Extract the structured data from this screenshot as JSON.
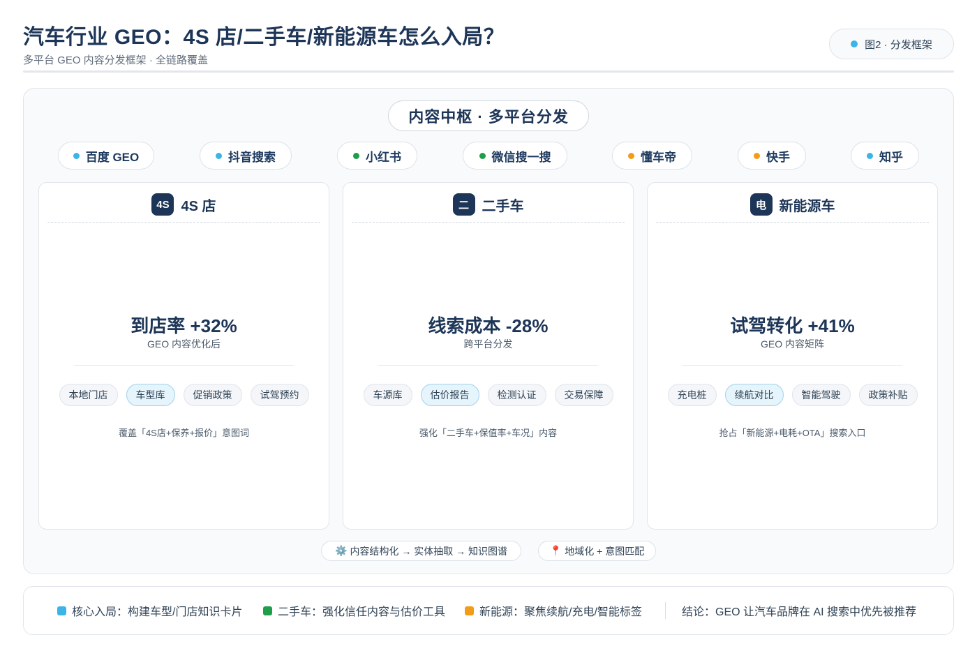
{
  "header": {
    "title": "汽车行业 GEO：4S 店/二手车/新能源车怎么入局？",
    "subtitle": "多平台 GEO 内容分发框架 · 全链路覆盖",
    "figure_badge": "图2 · 分发框架",
    "figure_badge_color": "#3cb4e6"
  },
  "hub": {
    "label": "内容中枢 · 多平台分发"
  },
  "platforms": [
    {
      "label": "百度 GEO",
      "color": "#3cb4e6"
    },
    {
      "label": "抖音搜索",
      "color": "#3cb4e6"
    },
    {
      "label": "小红书",
      "color": "#1e9e4a"
    },
    {
      "label": "微信搜一搜",
      "color": "#1e9e4a"
    },
    {
      "label": "懂车帝",
      "color": "#f39c1a"
    },
    {
      "label": "快手",
      "color": "#f39c1a"
    },
    {
      "label": "知乎",
      "color": "#3cb4e6"
    }
  ],
  "cards": [
    {
      "icon_text": "4S",
      "name": "4S 店",
      "metric": "到店率 +32%",
      "metric_sub": "GEO 内容优化后",
      "tags": [
        {
          "label": "本地门店",
          "highlight": false
        },
        {
          "label": "车型库",
          "highlight": true
        },
        {
          "label": "促销政策",
          "highlight": false
        },
        {
          "label": "试驾预约",
          "highlight": false
        }
      ],
      "note": "覆盖「4S店+保养+报价」意图词"
    },
    {
      "icon_text": "二",
      "name": "二手车",
      "metric": "线索成本 -28%",
      "metric_sub": "跨平台分发",
      "tags": [
        {
          "label": "车源库",
          "highlight": false
        },
        {
          "label": "估价报告",
          "highlight": true
        },
        {
          "label": "检测认证",
          "highlight": false
        },
        {
          "label": "交易保障",
          "highlight": false
        }
      ],
      "note": "强化「二手车+保值率+车况」内容"
    },
    {
      "icon_text": "电",
      "name": "新能源车",
      "metric": "试驾转化 +41%",
      "metric_sub": "GEO 内容矩阵",
      "tags": [
        {
          "label": "充电桩",
          "highlight": false
        },
        {
          "label": "续航对比",
          "highlight": true
        },
        {
          "label": "智能驾驶",
          "highlight": false
        },
        {
          "label": "政策补贴",
          "highlight": false
        }
      ],
      "note": "抢占「新能源+电耗+OTA」搜索入口"
    }
  ],
  "tech_pills": [
    {
      "icon": "⚙️",
      "icon_name": "gear-icon",
      "label": "内容结构化 → 实体抽取 → 知识图谱"
    },
    {
      "icon": "📍",
      "icon_name": "pin-icon",
      "label": "地域化 + 意图匹配"
    }
  ],
  "legend": {
    "items": [
      {
        "label": "核心入局：构建车型/门店知识卡片",
        "color": "#3cb4e6"
      },
      {
        "label": "二手车：强化信任内容与估价工具",
        "color": "#1e9e4a"
      },
      {
        "label": "新能源：聚焦续航/充电/智能标签",
        "color": "#f39c1a"
      }
    ],
    "conclusion": "结论：GEO 让汽车品牌在 AI 搜索中优先被推荐"
  }
}
